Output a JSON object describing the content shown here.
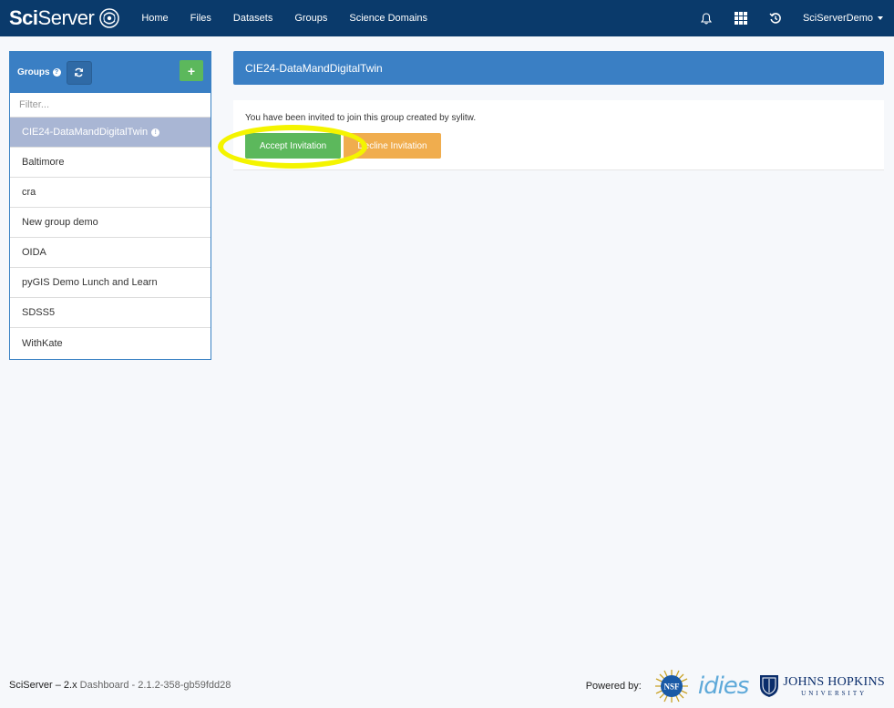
{
  "navbar": {
    "brand_bold": "Sci",
    "brand_light": "Server",
    "links": [
      "Home",
      "Files",
      "Datasets",
      "Groups",
      "Science Domains"
    ],
    "user_name": "SciServerDemo"
  },
  "sidebar": {
    "title": "Groups",
    "help_glyph": "?",
    "add_glyph": "+",
    "filter_placeholder": "Filter...",
    "groups": [
      "CIE24-DataMandDigitalTwin",
      "Baltimore",
      "cra",
      "New group demo",
      "OIDA",
      "pyGIS Demo Lunch and Learn",
      "SDSS5",
      "WithKate"
    ],
    "active_badge": "!"
  },
  "main": {
    "title": "CIE24-DataMandDigitalTwin",
    "invite_text": "You have been invited to join this group created by sylitw.",
    "accept_label": "Accept Invitation",
    "decline_label": "Decline Invitation"
  },
  "footer": {
    "app_version_label": "SciServer – 2.x",
    "build_label": "Dashboard - 2.1.2-358-gb59fdd28",
    "powered_by": "Powered by:",
    "nsf_text": "NSF",
    "idies_text": "idies",
    "jhu_name": "JOHNS HOPKINS",
    "jhu_univ": "UNIVERSITY"
  },
  "colors": {
    "navbar": "#0a3a6b",
    "panel_blue": "#3a7fc4",
    "active_group": "#a9b6d4",
    "accept_green": "#5cb85c",
    "decline_orange": "#f0ad4e",
    "highlight_yellow": "#f4f400"
  },
  "icons": [
    "globe-icon",
    "bell-icon",
    "apps-grid-icon",
    "history-icon",
    "help-icon",
    "refresh-icon",
    "plus-icon",
    "info-icon",
    "nsf-logo",
    "jhu-shield-icon"
  ]
}
